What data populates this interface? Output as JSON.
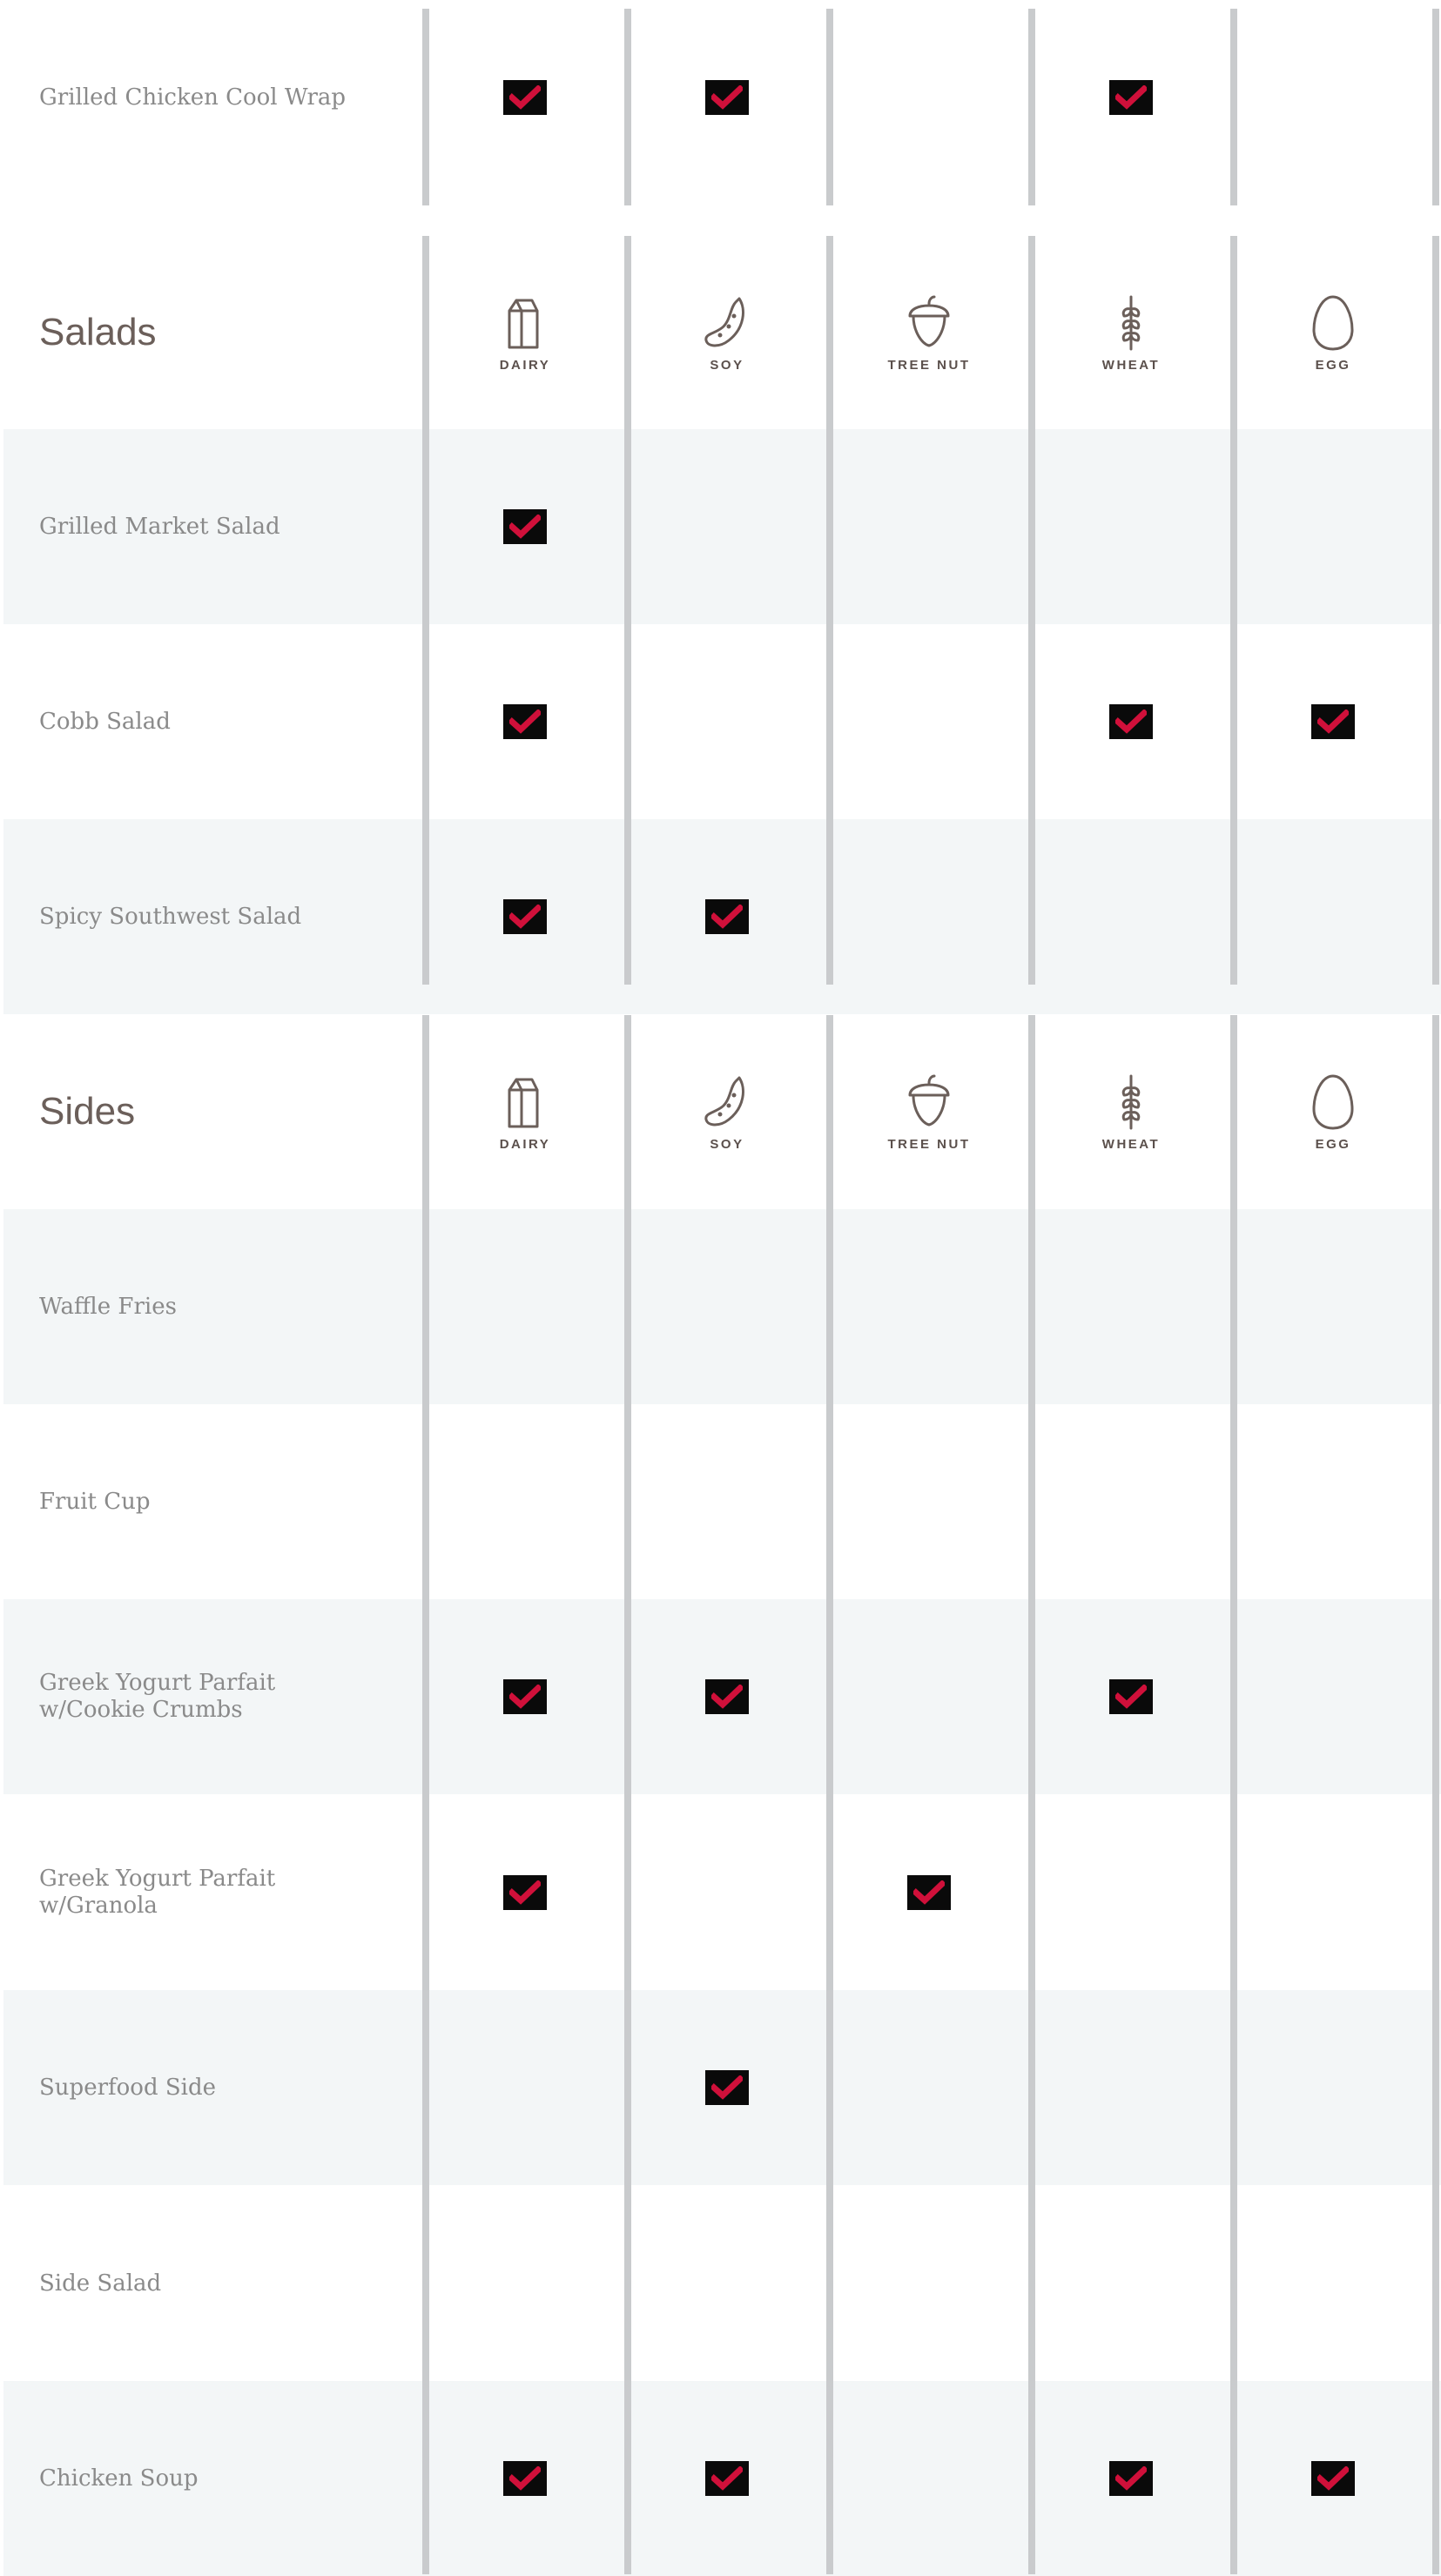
{
  "allergens": [
    {
      "key": "dairy",
      "label": "DAIRY",
      "icon": "milk-carton-icon"
    },
    {
      "key": "soy",
      "label": "SOY",
      "icon": "soybean-icon"
    },
    {
      "key": "tree_nut",
      "label": "TREE NUT",
      "icon": "acorn-icon"
    },
    {
      "key": "wheat",
      "label": "WHEAT",
      "icon": "wheat-icon"
    },
    {
      "key": "egg",
      "label": "EGG",
      "icon": "egg-icon"
    }
  ],
  "colors": {
    "check_mark": "#d0103a",
    "check_background": "#0a0a0a",
    "row_alt": "#f3f6f7",
    "divider": "#c9cbcd",
    "section_text": "#6b5f5a",
    "item_text": "#8a8a8a"
  },
  "rows": [
    {
      "type": "item",
      "name": "Grilled Chicken Cool Wrap",
      "shade": "white",
      "checks": [
        true,
        true,
        false,
        true,
        false
      ]
    },
    {
      "type": "section",
      "name": "Salads"
    },
    {
      "type": "item",
      "name": "Grilled Market Salad",
      "shade": "alt",
      "checks": [
        true,
        false,
        false,
        false,
        false
      ]
    },
    {
      "type": "item",
      "name": "Cobb Salad",
      "shade": "white",
      "checks": [
        true,
        false,
        false,
        true,
        true
      ]
    },
    {
      "type": "item",
      "name": "Spicy Southwest Salad",
      "shade": "alt",
      "checks": [
        true,
        true,
        false,
        false,
        false
      ]
    },
    {
      "type": "section",
      "name": "Sides"
    },
    {
      "type": "item",
      "name": "Waffle Fries",
      "shade": "alt",
      "checks": [
        false,
        false,
        false,
        false,
        false
      ]
    },
    {
      "type": "item",
      "name": "Fruit Cup",
      "shade": "white",
      "checks": [
        false,
        false,
        false,
        false,
        false
      ]
    },
    {
      "type": "item",
      "name": "Greek Yogurt Parfait w/Cookie Crumbs",
      "shade": "alt",
      "checks": [
        true,
        true,
        false,
        true,
        false
      ]
    },
    {
      "type": "item",
      "name": "Greek Yogurt Parfait w/Granola",
      "shade": "white",
      "checks": [
        true,
        false,
        true,
        false,
        false
      ]
    },
    {
      "type": "item",
      "name": "Superfood Side",
      "shade": "alt",
      "checks": [
        false,
        true,
        false,
        false,
        false
      ]
    },
    {
      "type": "item",
      "name": "Side Salad",
      "shade": "white",
      "checks": [
        false,
        false,
        false,
        false,
        false
      ]
    },
    {
      "type": "item",
      "name": "Chicken Soup",
      "shade": "alt",
      "checks": [
        true,
        true,
        false,
        true,
        true
      ]
    }
  ]
}
